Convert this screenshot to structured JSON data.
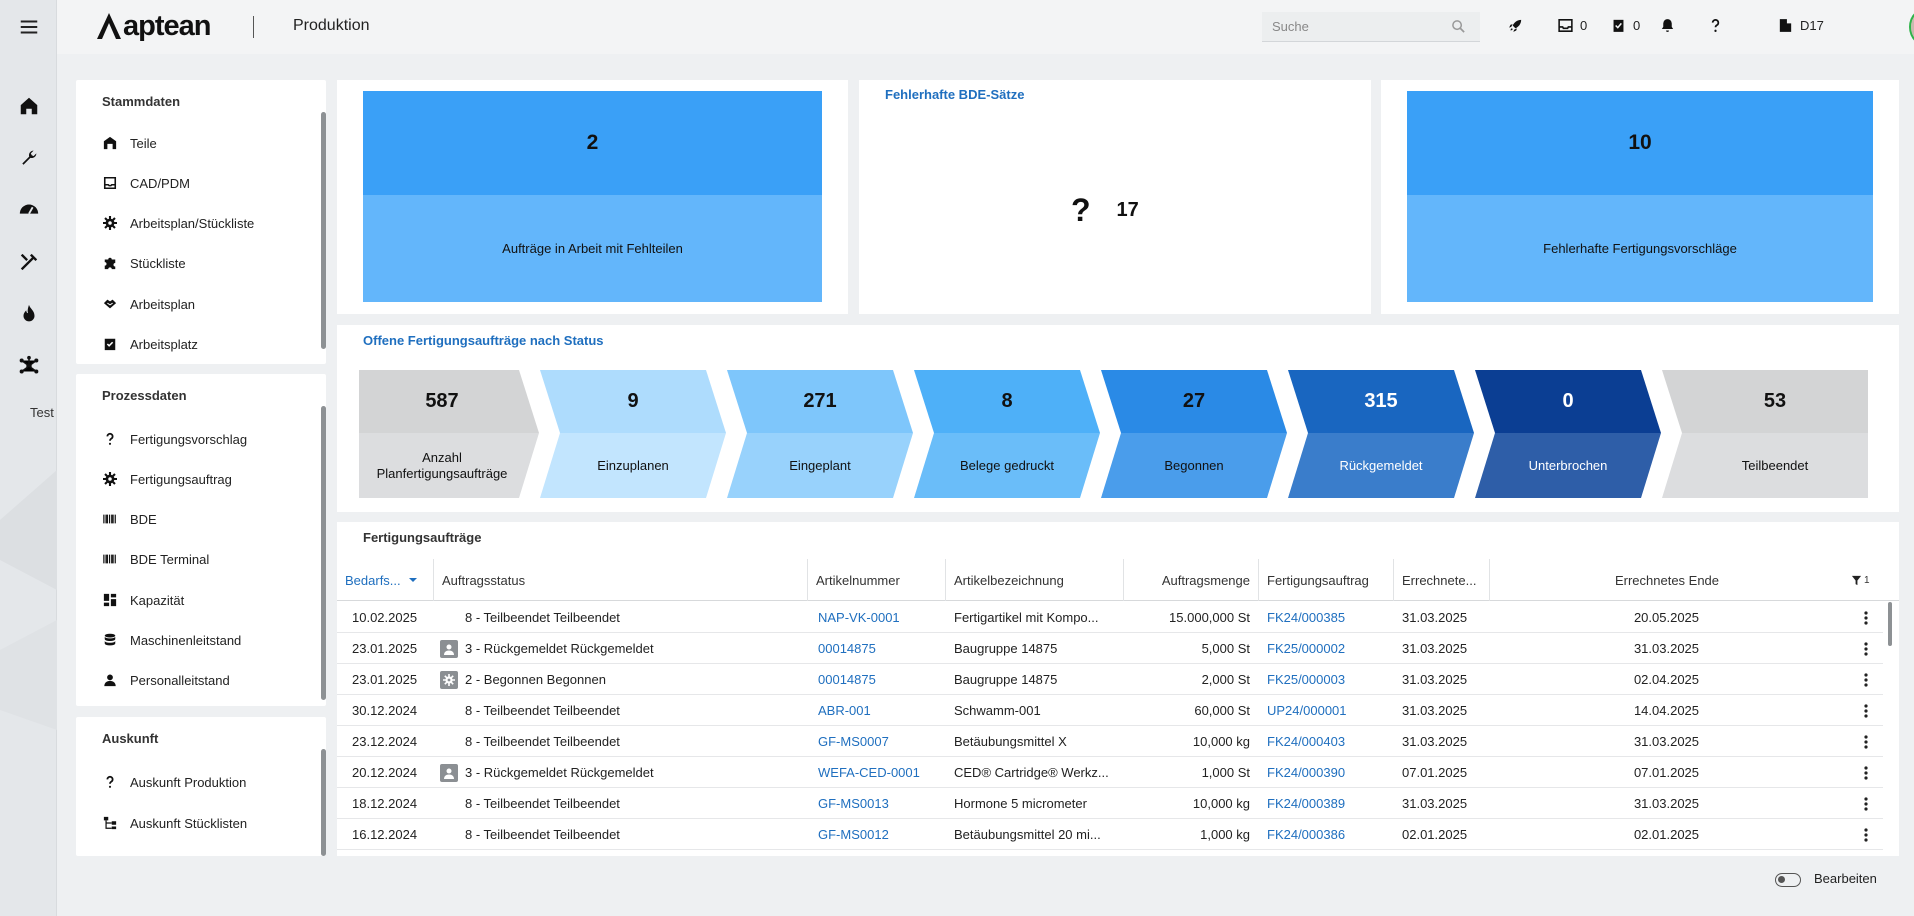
{
  "brand": {
    "logo_text": "aptean",
    "app_title": "Produktion"
  },
  "rail": {
    "items": [
      "home-icon",
      "wrench-icon",
      "gauge-icon",
      "tools-icon",
      "flame-icon",
      "network-icon"
    ],
    "text": "Test"
  },
  "header": {
    "search_placeholder": "Suche",
    "inbox_count": "0",
    "tasks_count": "0",
    "company": "D17"
  },
  "stammdaten": {
    "title": "Stammdaten",
    "items": [
      {
        "label": "Teile",
        "icon": "warehouse-icon"
      },
      {
        "label": "CAD/PDM",
        "icon": "inbox-icon"
      },
      {
        "label": "Arbeitsplan/Stückliste",
        "icon": "gear-icon"
      },
      {
        "label": "Stückliste",
        "icon": "puzzle-icon"
      },
      {
        "label": "Arbeitsplan",
        "icon": "handshake-icon"
      },
      {
        "label": "Arbeitsplatz",
        "icon": "clipboard-check-icon"
      }
    ]
  },
  "prozessdaten": {
    "title": "Prozessdaten",
    "items": [
      {
        "label": "Fertigungsvorschlag",
        "icon": "question-icon"
      },
      {
        "label": "Fertigungsauftrag",
        "icon": "gear-icon"
      },
      {
        "label": "BDE",
        "icon": "barcode-icon"
      },
      {
        "label": "BDE Terminal",
        "icon": "barcode-icon"
      },
      {
        "label": "Kapazität",
        "icon": "dashboard-icon"
      },
      {
        "label": "Maschinenleitstand",
        "icon": "database-icon"
      },
      {
        "label": "Personalleitstand",
        "icon": "person-icon"
      }
    ]
  },
  "auskunft": {
    "title": "Auskunft",
    "items": [
      {
        "label": "Auskunft Produktion",
        "icon": "question-icon"
      },
      {
        "label": "Auskunft Stücklisten",
        "icon": "tree-icon"
      }
    ]
  },
  "kpi": {
    "missing_parts": {
      "value": "2",
      "label": "Aufträge in Arbeit mit Fehlteilen"
    },
    "bde": {
      "title": "Fehlerhafte BDE-Sätze",
      "value": "17"
    },
    "proposals": {
      "value": "10",
      "label": "Fehlerhafte Fertigungsvorschläge"
    }
  },
  "flow": {
    "title": "Offene Fertigungsaufträge nach Status",
    "steps": [
      {
        "value": "587",
        "label": "Anzahl Planfertigungsaufträge",
        "top": "#d3d4d5",
        "bottom": "#dcdddf",
        "text": "#111111"
      },
      {
        "value": "9",
        "label": "Einzuplanen",
        "top": "#aedcfd",
        "bottom": "#c2e5fe",
        "text": "#111111"
      },
      {
        "value": "271",
        "label": "Eingeplant",
        "top": "#7ec6fb",
        "bottom": "#98d2fc",
        "text": "#111111"
      },
      {
        "value": "8",
        "label": "Belege gedruckt",
        "top": "#4eb0f8",
        "bottom": "#6abdf9",
        "text": "#111111"
      },
      {
        "value": "27",
        "label": "Begonnen",
        "top": "#2a8ae6",
        "bottom": "#4a9deb",
        "text": "#111111"
      },
      {
        "value": "315",
        "label": "Rückgemeldet",
        "top": "#1966c0",
        "bottom": "#3a7dcb",
        "text": "#ffffff"
      },
      {
        "value": "0",
        "label": "Unterbrochen",
        "top": "#0b3e93",
        "bottom": "#2e5ea8",
        "text": "#ffffff"
      },
      {
        "value": "53",
        "label": "Teilbeendet",
        "top": "#d3d4d5",
        "bottom": "#dcdddf",
        "text": "#111111"
      }
    ]
  },
  "orders": {
    "title": "Fertigungsaufträge",
    "columns": [
      "Bedarfs...",
      "Auftragsstatus",
      "Artikelnummer",
      "Artikelbezeichnung",
      "Auftragsmenge",
      "Fertigungsauftrag",
      "Errechnete...",
      "Errechnetes Ende"
    ],
    "filter_count": "1",
    "rows": [
      [
        "10.02.2025",
        "8 - Teilbeendet Teilbeendet",
        "NAP-VK-0001",
        "Fertigartikel mit Kompo...",
        "15.000,000 St",
        "FK24/000385",
        "31.03.2025",
        "20.05.2025",
        ""
      ],
      [
        "23.01.2025",
        "3 - Rückgemeldet Rückgemeldet",
        "00014875",
        "Baugruppe 14875",
        "5,000 St",
        "FK25/000002",
        "31.03.2025",
        "31.03.2025",
        "person"
      ],
      [
        "23.01.2025",
        "2 - Begonnen Begonnen",
        "00014875",
        "Baugruppe 14875",
        "2,000 St",
        "FK25/000003",
        "31.03.2025",
        "02.04.2025",
        "gear"
      ],
      [
        "30.12.2024",
        "8 - Teilbeendet Teilbeendet",
        "ABR-001",
        "Schwamm-001",
        "60,000 St",
        "UP24/000001",
        "31.03.2025",
        "14.04.2025",
        ""
      ],
      [
        "23.12.2024",
        "8 - Teilbeendet Teilbeendet",
        "GF-MS0007",
        "Betäubungsmittel X",
        "10,000 kg",
        "FK24/000403",
        "31.03.2025",
        "31.03.2025",
        ""
      ],
      [
        "20.12.2024",
        "3 - Rückgemeldet Rückgemeldet",
        "WEFA-CED-0001",
        "CED® Cartridge® Werkz...",
        "1,000 St",
        "FK24/000390",
        "07.01.2025",
        "07.01.2025",
        "person"
      ],
      [
        "18.12.2024",
        "8 - Teilbeendet Teilbeendet",
        "GF-MS0013",
        "Hormone 5 micrometer",
        "10,000 kg",
        "FK24/000389",
        "31.03.2025",
        "31.03.2025",
        ""
      ],
      [
        "16.12.2024",
        "8 - Teilbeendet Teilbeendet",
        "GF-MS0012",
        "Betäubungsmittel 20 mi...",
        "1,000 kg",
        "FK24/000386",
        "02.01.2025",
        "02.01.2025",
        ""
      ]
    ]
  },
  "footer": {
    "edit_label": "Bearbeiten"
  }
}
